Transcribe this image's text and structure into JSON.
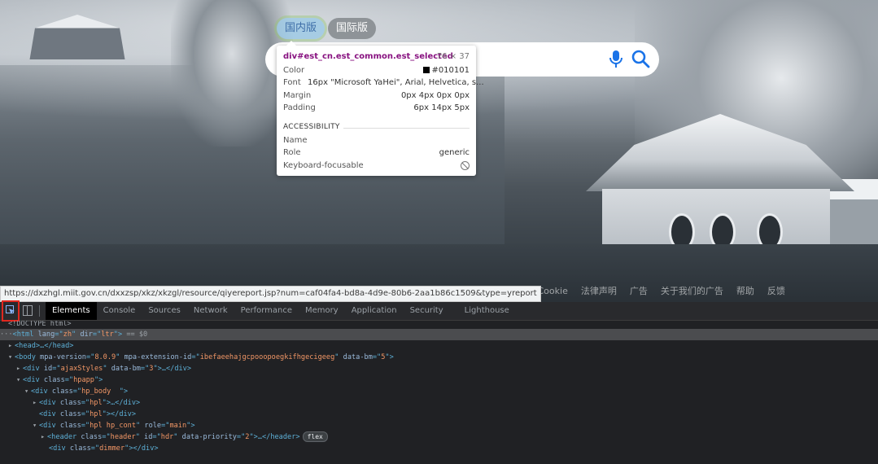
{
  "region_tabs": [
    {
      "label": "国内版",
      "selected": true
    },
    {
      "label": "国际版",
      "selected": false
    }
  ],
  "search": {
    "mic_icon": "microphone-icon",
    "search_icon": "search-icon"
  },
  "inspect_tooltip": {
    "selector": "div#est_cn.est_common.est_selected",
    "size": "76 × 37",
    "rows": [
      {
        "key": "Color",
        "value": "#010101",
        "swatch": "#010101"
      },
      {
        "key": "Font",
        "value": "16px \"Microsoft YaHei\", Arial, Helvetica, s..."
      },
      {
        "key": "Margin",
        "value": "0px 4px 0px 0px"
      },
      {
        "key": "Padding",
        "value": "6px 14px 5px"
      }
    ],
    "accessibility_title": "ACCESSIBILITY",
    "accessibility": [
      {
        "key": "Name",
        "value": ""
      },
      {
        "key": "Role",
        "value": "generic"
      },
      {
        "key": "Keyboard-focusable",
        "value": "",
        "icon": "not-allowed-icon"
      }
    ]
  },
  "status_url": "https://dxzhgl.miit.gov.cn/dxxzsp/xkz/xkzgl/resource/qiyereport.jsp?num=caf04fa4-bd8a-4d9e-80b6-2aa1b86c1509&type=yreport",
  "footer_links": [
    "隐私与 Cookie",
    "法律声明",
    "广告",
    "关于我们的广告",
    "帮助",
    "反馈"
  ],
  "devtools": {
    "tabs": [
      "Elements",
      "Console",
      "Sources",
      "Network",
      "Performance",
      "Memory",
      "Application",
      "Security",
      "Lighthouse"
    ],
    "active_tab": "Elements",
    "dom": {
      "doctype": "<!DOCTYPE html>",
      "html_lang": "zh",
      "html_dir": "ltr",
      "eq0": "== $0",
      "head": "<head>…</head>",
      "body_mpa_version": "8.0.9",
      "body_mpa_ext": "ibefaeehajgcpooopoegkifhgecigeeg",
      "body_data_bm": "5",
      "ajax_id": "ajaxStyles",
      "ajax_bm": "3",
      "hpapp_class": "hpapp",
      "hp_body_class": "hp_body  ",
      "hpl_class": "hpl",
      "hpl_cont_class": "hpl hp_cont",
      "hpl_cont_role": "main",
      "header_class": "header",
      "header_id": "hdr",
      "header_priority": "2",
      "flex_badge": "flex",
      "dimmer_class": "dimmer"
    }
  }
}
